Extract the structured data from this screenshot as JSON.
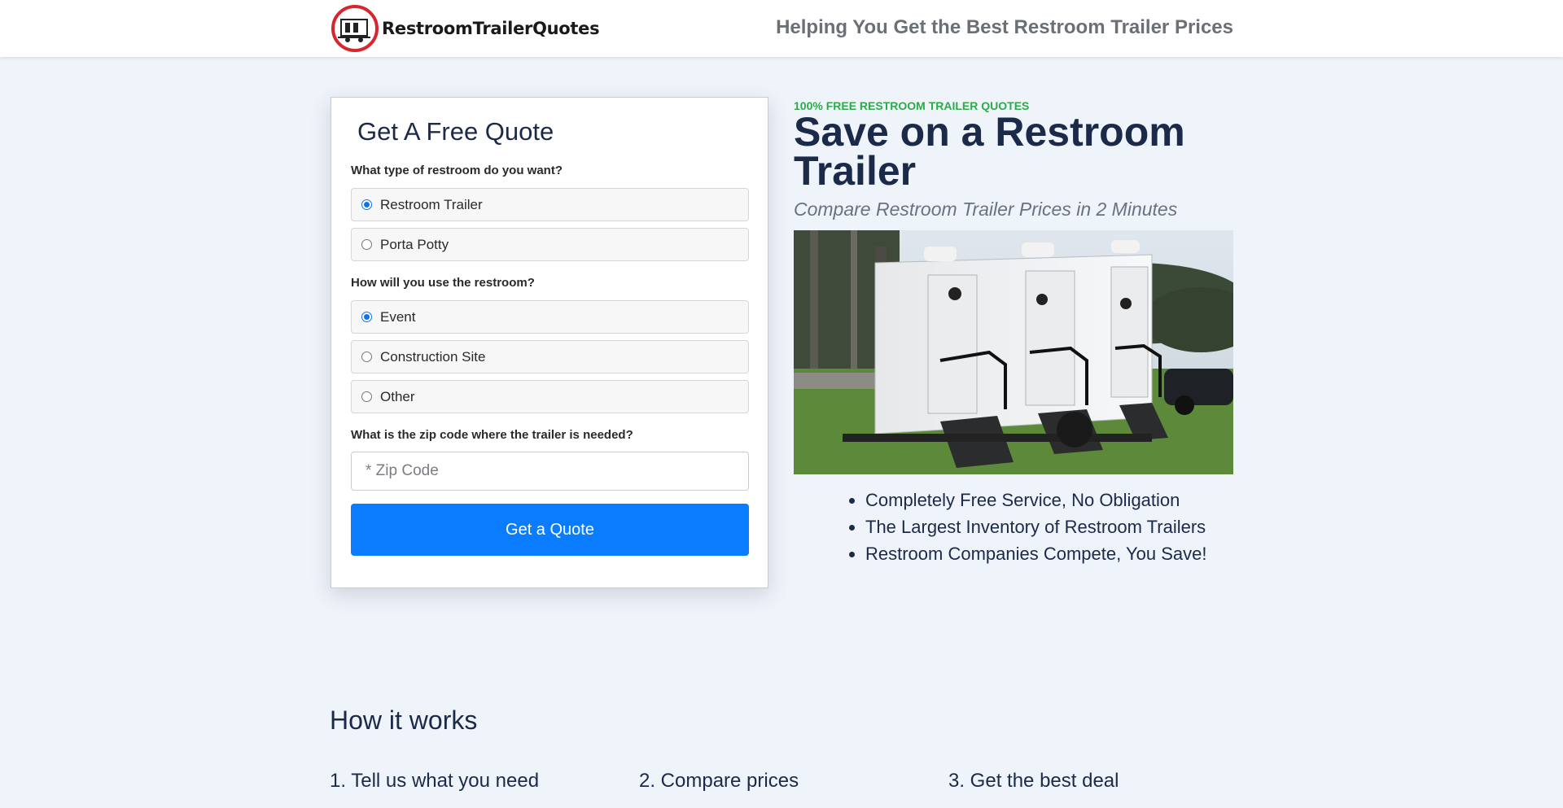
{
  "header": {
    "logo_text": "RestroomTrailerQuotes",
    "tagline": "Helping You Get the Best Restroom Trailer Prices"
  },
  "form": {
    "title": "Get A Free Quote",
    "q1": {
      "label": "What type of restroom do you want?",
      "options": [
        "Restroom Trailer",
        "Porta Potty"
      ],
      "selected": "Restroom Trailer"
    },
    "q2": {
      "label": "How will you use the restroom?",
      "options": [
        "Event",
        "Construction Site",
        "Other"
      ],
      "selected": "Event"
    },
    "q3": {
      "label": "What is the zip code where the trailer is needed?",
      "zip_placeholder": "* Zip Code",
      "zip_value": ""
    },
    "submit_label": "Get a Quote"
  },
  "hero": {
    "kicker": "100% FREE RESTROOM TRAILER QUOTES",
    "title": "Save on a Restroom Trailer",
    "subtitle": "Compare Restroom Trailer Prices in 2 Minutes",
    "bullets": [
      "Completely Free Service, No Obligation",
      "The Largest Inventory of Restroom Trailers",
      "Restroom Companies Compete, You Save!"
    ]
  },
  "how": {
    "title": "How it works",
    "steps": [
      {
        "title": "1. Tell us what you need"
      },
      {
        "title": "2. Compare prices"
      },
      {
        "title": "3. Get the best deal"
      }
    ]
  },
  "colors": {
    "accent": "#0a7cff",
    "kicker": "#2eaa4a",
    "heading": "#1c2a4a",
    "background": "#eff3fa"
  }
}
